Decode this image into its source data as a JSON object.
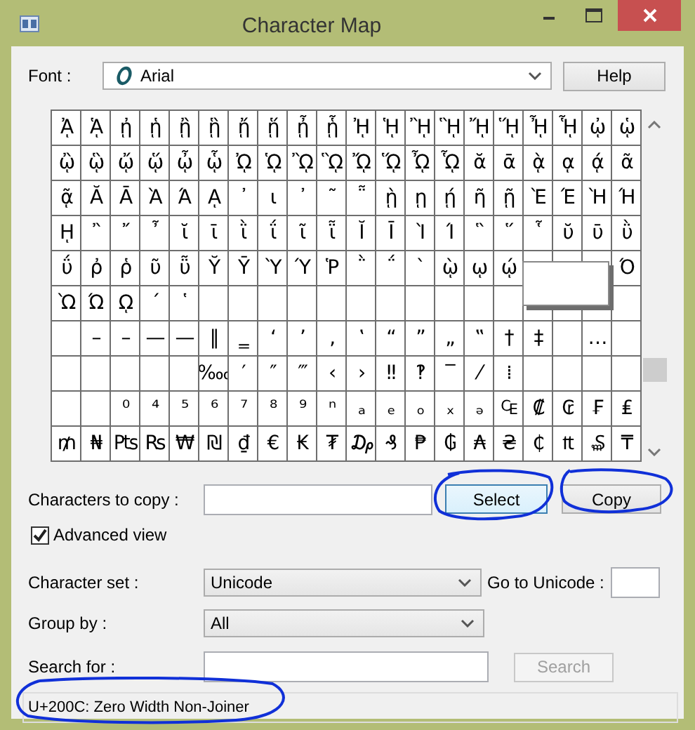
{
  "window": {
    "title": "Character Map"
  },
  "font": {
    "label": "Font :",
    "value": "Arial"
  },
  "help_button": "Help",
  "grid": {
    "rows": [
      [
        "ᾈ",
        "ᾉ",
        "ᾐ",
        "ᾑ",
        "ᾒ",
        "ᾓ",
        "ᾔ",
        "ᾕ",
        "ᾖ",
        "ᾗ",
        "ᾘ",
        "ᾙ",
        "ᾚ",
        "ᾛ",
        "ᾜ",
        "ᾝ",
        "ᾞ",
        "ᾟ",
        "ᾠ",
        "ᾡ"
      ],
      [
        "ᾢ",
        "ᾣ",
        "ᾤ",
        "ᾥ",
        "ᾦ",
        "ᾧ",
        "ᾨ",
        "ᾩ",
        "ᾪ",
        "ᾫ",
        "ᾬ",
        "ᾭ",
        "ᾮ",
        "ᾯ",
        "ᾰ",
        "ᾱ",
        "ᾲ",
        "ᾳ",
        "ᾴ",
        "ᾶ"
      ],
      [
        "ᾷ",
        "Ᾰ",
        "Ᾱ",
        "Ὰ",
        "Ά",
        "ᾼ",
        "᾽",
        "ι",
        "᾿",
        "῀",
        "῁",
        "ῂ",
        "ῃ",
        "ῄ",
        "ῆ",
        "ῇ",
        "Ὲ",
        "Έ",
        "Ὴ",
        "Ή"
      ],
      [
        "ῌ",
        "῍",
        "῎",
        "῏",
        "ῐ",
        "ῑ",
        "ῒ",
        "ΐ",
        "ῖ",
        "ῗ",
        "Ῐ",
        "Ῑ",
        "Ὶ",
        "Ί",
        "῝",
        "῞",
        "῟",
        "ῠ",
        "ῡ",
        "ῢ"
      ],
      [
        "ΰ",
        "ῤ",
        "ῥ",
        "ῦ",
        "ῧ",
        "Ῠ",
        "Ῡ",
        "Ὺ",
        "Ύ",
        "Ῥ",
        "῭",
        "΅",
        "`",
        "ῲ",
        "ῳ",
        "ῴ",
        null,
        null,
        null,
        "Ό"
      ],
      [
        "Ὼ",
        "Ώ",
        "ῼ",
        "´",
        "῾",
        null,
        null,
        null,
        null,
        null,
        null,
        null,
        null,
        null,
        null,
        null,
        null,
        null,
        null,
        null
      ],
      [
        null,
        "–",
        "–",
        "—",
        "—",
        "‖",
        "‗",
        "‘",
        "’",
        "‚",
        "‛",
        "“",
        "”",
        "„",
        "‟",
        "†",
        "‡",
        null,
        "…",
        null
      ],
      [
        null,
        null,
        null,
        null,
        null,
        "‱",
        "′",
        "″",
        "‴",
        "‹",
        "›",
        "‼",
        "‽",
        "‾",
        "⁄",
        "⁞",
        null,
        null,
        null,
        null
      ],
      [
        null,
        null,
        "⁰",
        "⁴",
        "⁵",
        "⁶",
        "⁷",
        "⁸",
        "⁹",
        "ⁿ",
        "ₐ",
        "ₑ",
        "ₒ",
        "ₓ",
        "ₔ",
        "₠",
        "₡",
        "₢",
        "₣",
        "₤"
      ],
      [
        "₥",
        "₦",
        "₧",
        "₨",
        "₩",
        "₪",
        "₫",
        "€",
        "₭",
        "₮",
        "₯",
        "₰",
        "₱",
        "₲",
        "₳",
        "₴",
        "₵",
        "₶",
        "₷",
        "₸"
      ]
    ]
  },
  "copy": {
    "label": "Characters to copy :"
  },
  "select_button": "Select",
  "copy_button": "Copy",
  "advanced_view": {
    "label": "Advanced view",
    "checked": true
  },
  "character_set": {
    "label": "Character set :",
    "value": "Unicode"
  },
  "go_to_unicode": {
    "label": "Go to Unicode :"
  },
  "group_by": {
    "label": "Group by :",
    "value": "All"
  },
  "search": {
    "label": "Search for :",
    "button": "Search",
    "button_disabled": true
  },
  "status_bar": "U+200C: Zero Width Non-Joiner"
}
